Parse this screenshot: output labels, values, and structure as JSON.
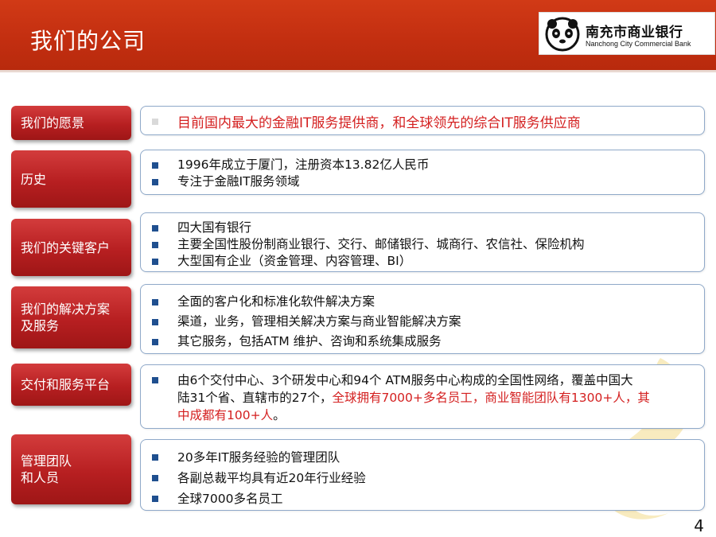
{
  "header": {
    "title": "我们的公司",
    "logo": {
      "cn": "南充市商业银行",
      "en": "Nanchong City Commercial Bank"
    }
  },
  "rows": [
    {
      "label": [
        "我们的愿景"
      ],
      "bullets": [
        "目前国内最大的金融IT服务提供商，和全球领先的综合IT服务供应商"
      ]
    },
    {
      "label": [
        "历史"
      ],
      "bullets": [
        "1996年成立于厦门，注册资本13.82亿人民币",
        "专注于金融IT服务领域"
      ]
    },
    {
      "label": [
        "我们的关键客户"
      ],
      "bullets": [
        "四大国有银行",
        "主要全国性股份制商业银行、交行、邮储银行、城商行、农信社、保险机构",
        "大型国有企业（资金管理、内容管理、BI）"
      ]
    },
    {
      "label": [
        "我们的解决方案",
        "及服务"
      ],
      "bullets": [
        "全面的客户化和标准化软件解决方案",
        "渠道，业务，管理相关解决方案与商业智能解决方案",
        "其它服务，包括ATM 维护、咨询和系统集成服务"
      ]
    },
    {
      "label": [
        "交付和服务平台"
      ],
      "lines": [
        {
          "black": "由6个交付中心、3个研发中心和94个 ATM服务中心构成的全国性网络，覆盖中国大"
        },
        {
          "black": "陆31个省、直辖市的27个，",
          "red": "全球拥有7000+多名员工，商业智能团队有1300+人，其"
        },
        {
          "red": "中成都有100+人",
          "black": "。"
        }
      ]
    },
    {
      "label": [
        "管理团队",
        "和人员"
      ],
      "bullets": [
        "20多年IT服务经验的管理团队",
        "各副总裁平均具有近20年行业经验",
        "全球7000多名员工"
      ]
    }
  ],
  "page_number": "4",
  "colors": {
    "header": "#c22e10",
    "label": "#b71f21",
    "bullet": "#1f4f8f",
    "highlight": "#d42020",
    "vision_bullet": "#d9d9d9"
  }
}
